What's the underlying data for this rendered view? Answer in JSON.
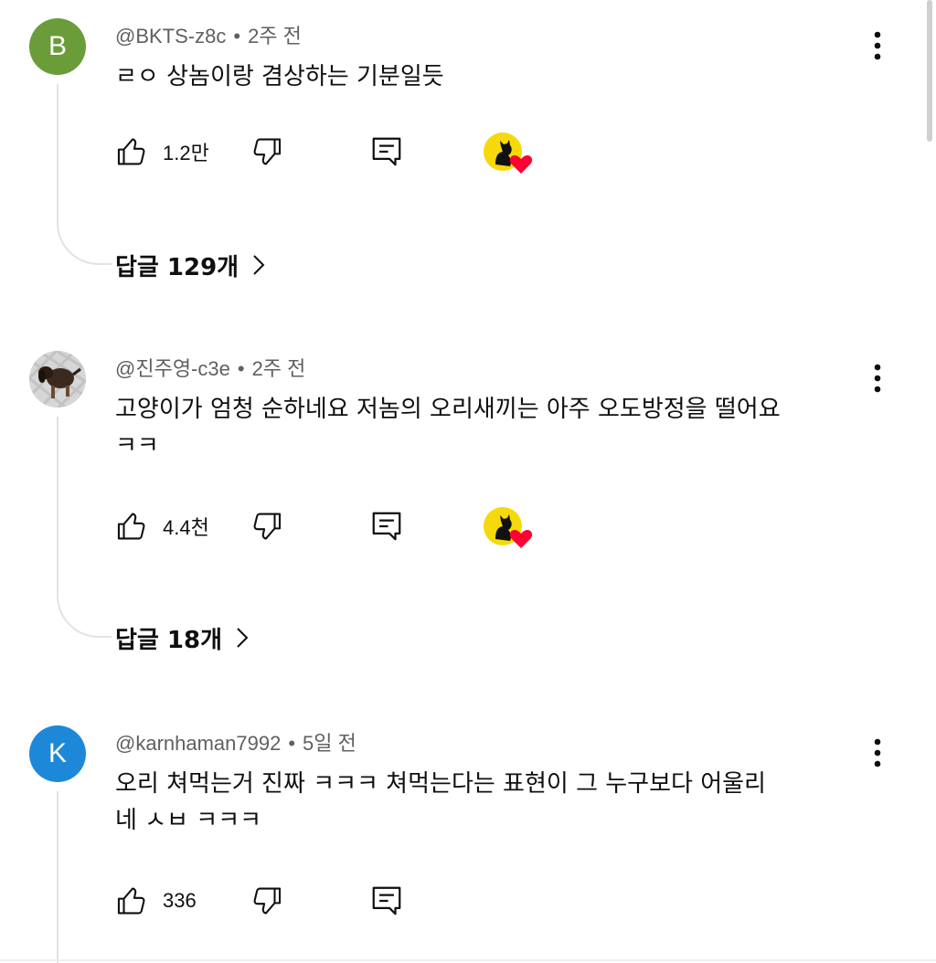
{
  "comments": [
    {
      "avatar_letter": "B",
      "avatar_color": "#6a9d3a",
      "author": "@BKTS-z8c",
      "time": "2주 전",
      "text": "ㄹㅇ 상놈이랑 겸상하는 기분일듯",
      "likes": "1.2만",
      "replies_label": "답글 129개"
    },
    {
      "avatar_icon": "dog-photo-avatar",
      "author": "@진주영-c3e",
      "time": "2주 전",
      "text": "고양이가 엄청 순하네요 저놈의 오리새끼는 아주 오도방정을 떨어요\nㅋㅋ",
      "likes": "4.4천",
      "replies_label": "답글 18개"
    },
    {
      "avatar_letter": "K",
      "avatar_color": "#1e88d8",
      "author": "@karnhaman7992",
      "time": "5일 전",
      "text": "오리 쳐먹는거 진짜 ㅋㅋㅋ 쳐먹는다는 표현이 그 누구보다 어울리\n네 ㅅㅂ ㅋㅋㅋ",
      "likes": "336"
    }
  ],
  "separator": "•",
  "icons": {
    "like": "thumbs-up-icon",
    "dislike": "thumbs-down-icon",
    "reply": "reply-icon",
    "more": "more-vert-icon",
    "creator_heart": "creator-heart-icon",
    "chevron": "chevron-right-icon"
  },
  "colors": {
    "meta_text": "#606060",
    "heart": "#ff0033",
    "creator_badge_bg": "#f5d90a"
  }
}
